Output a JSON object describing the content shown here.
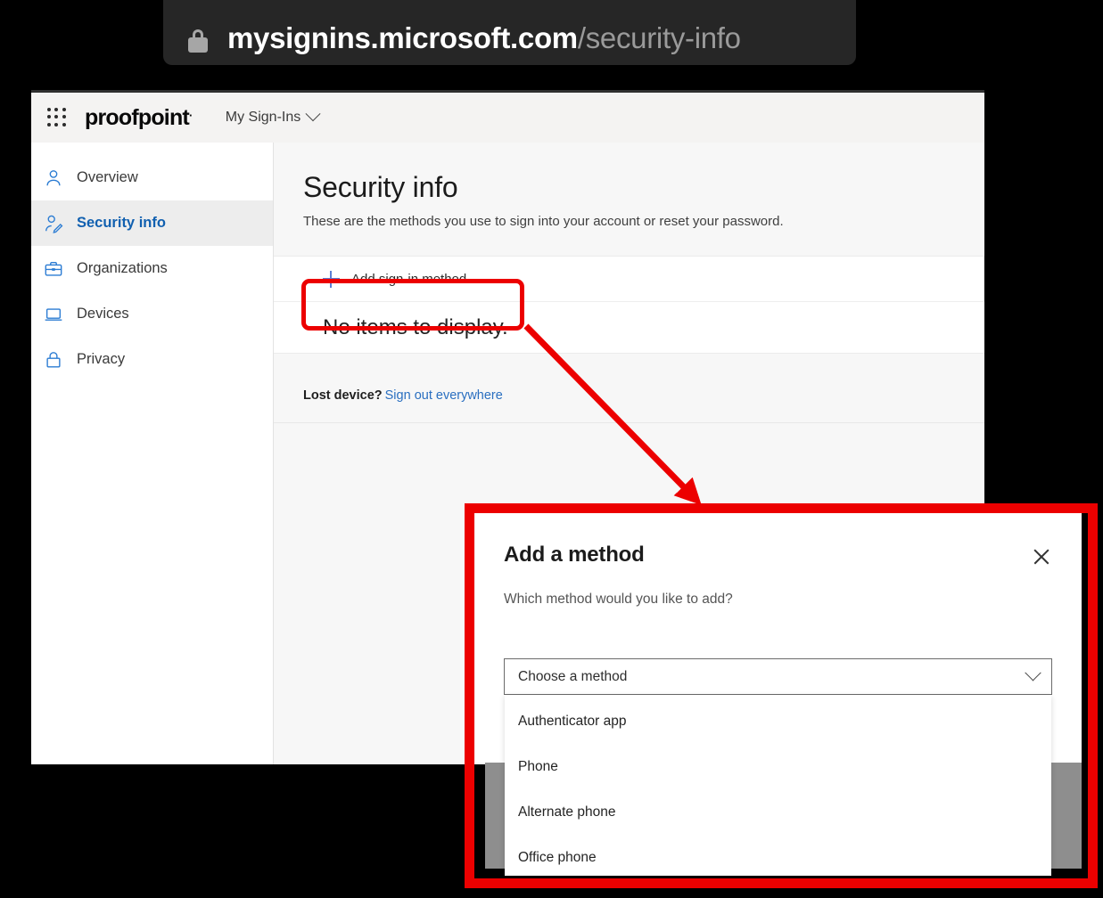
{
  "browser": {
    "lock_icon": "lock-icon",
    "url_host": "mysignins.microsoft.com",
    "url_path": "/security-info"
  },
  "header": {
    "waffle_icon": "app-launcher-waffle-icon",
    "brand": "proofpoint",
    "brand_tm": ".",
    "app_switcher": "My Sign-Ins",
    "chevron_icon": "chevron-down-icon"
  },
  "sidebar": {
    "items": [
      {
        "label": "Overview",
        "icon": "person-icon",
        "selected": false
      },
      {
        "label": "Security info",
        "icon": "person-edit-icon",
        "selected": true
      },
      {
        "label": "Organizations",
        "icon": "briefcase-icon",
        "selected": false
      },
      {
        "label": "Devices",
        "icon": "laptop-icon",
        "selected": false
      },
      {
        "label": "Privacy",
        "icon": "lock-icon",
        "selected": false
      }
    ]
  },
  "main": {
    "title": "Security info",
    "subtitle": "These are the methods you use to sign into your account or reset your password.",
    "add_method_label": "Add sign-in method",
    "add_method_icon": "plus-icon",
    "empty_text": "No items to display.",
    "lost_device_label": "Lost device?",
    "sign_out_link": "Sign out everywhere"
  },
  "dialog": {
    "title": "Add a method",
    "close_icon": "close-icon",
    "question": "Which method would you like to add?",
    "combobox": {
      "value": "Choose a method",
      "chevron_icon": "chevron-down-icon"
    },
    "options": [
      "Authenticator app",
      "Phone",
      "Alternate phone",
      "Office phone"
    ]
  },
  "annotations": {
    "highlight_color": "#ec0000",
    "arrow_icon": "red-arrow-icon"
  },
  "colors": {
    "accent_blue": "#1160b0",
    "link_blue": "#2a6fc0",
    "icon_blue": "#2b7cd3",
    "annotation_red": "#ec0000",
    "url_bar_bg": "#262626"
  }
}
